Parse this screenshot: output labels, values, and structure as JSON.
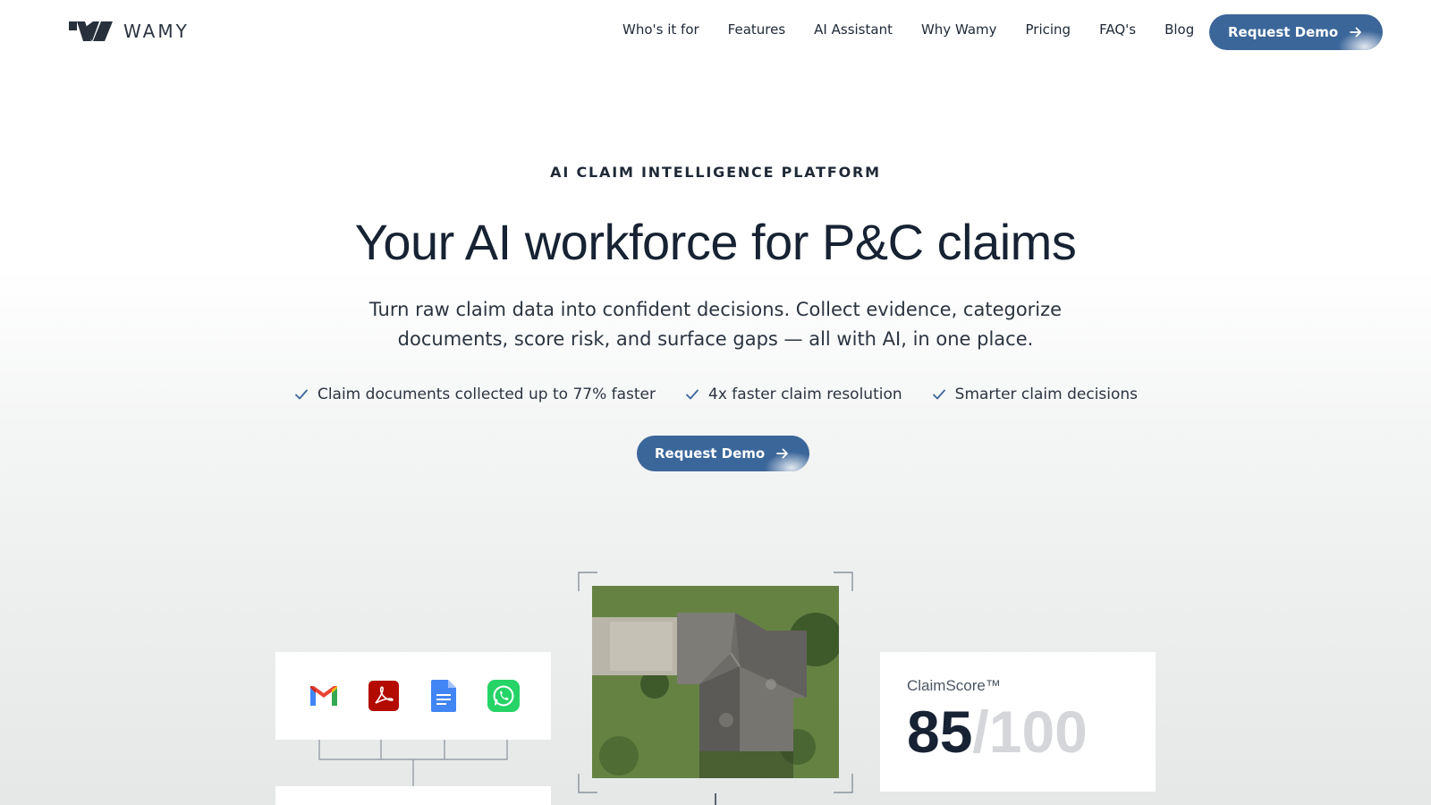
{
  "brand": {
    "name": "WAMY"
  },
  "nav": {
    "links": [
      "Who's it for",
      "Features",
      "AI Assistant",
      "Why Wamy",
      "Pricing",
      "FAQ's",
      "Blog"
    ],
    "cta_label": "Request Demo"
  },
  "hero": {
    "eyebrow": "AI CLAIM INTELLIGENCE PLATFORM",
    "title": "Your AI workforce for P&C claims",
    "subtitle_line1": "Turn raw claim data into confident decisions. Collect evidence, categorize",
    "subtitle_line2": "documents, score risk, and surface gaps — all with AI, in one place.",
    "benefits": [
      "Claim documents collected up to 77% faster",
      "4x faster claim resolution",
      "Smarter claim decisions"
    ],
    "cta_label": "Request Demo"
  },
  "visual": {
    "source_icons": [
      "gmail-icon",
      "pdf-icon",
      "google-docs-icon",
      "whatsapp-icon"
    ],
    "score": {
      "label": "ClaimScore™",
      "value": "85",
      "max": "/100"
    }
  },
  "colors": {
    "accent": "#3b6699",
    "text": "#172233"
  }
}
